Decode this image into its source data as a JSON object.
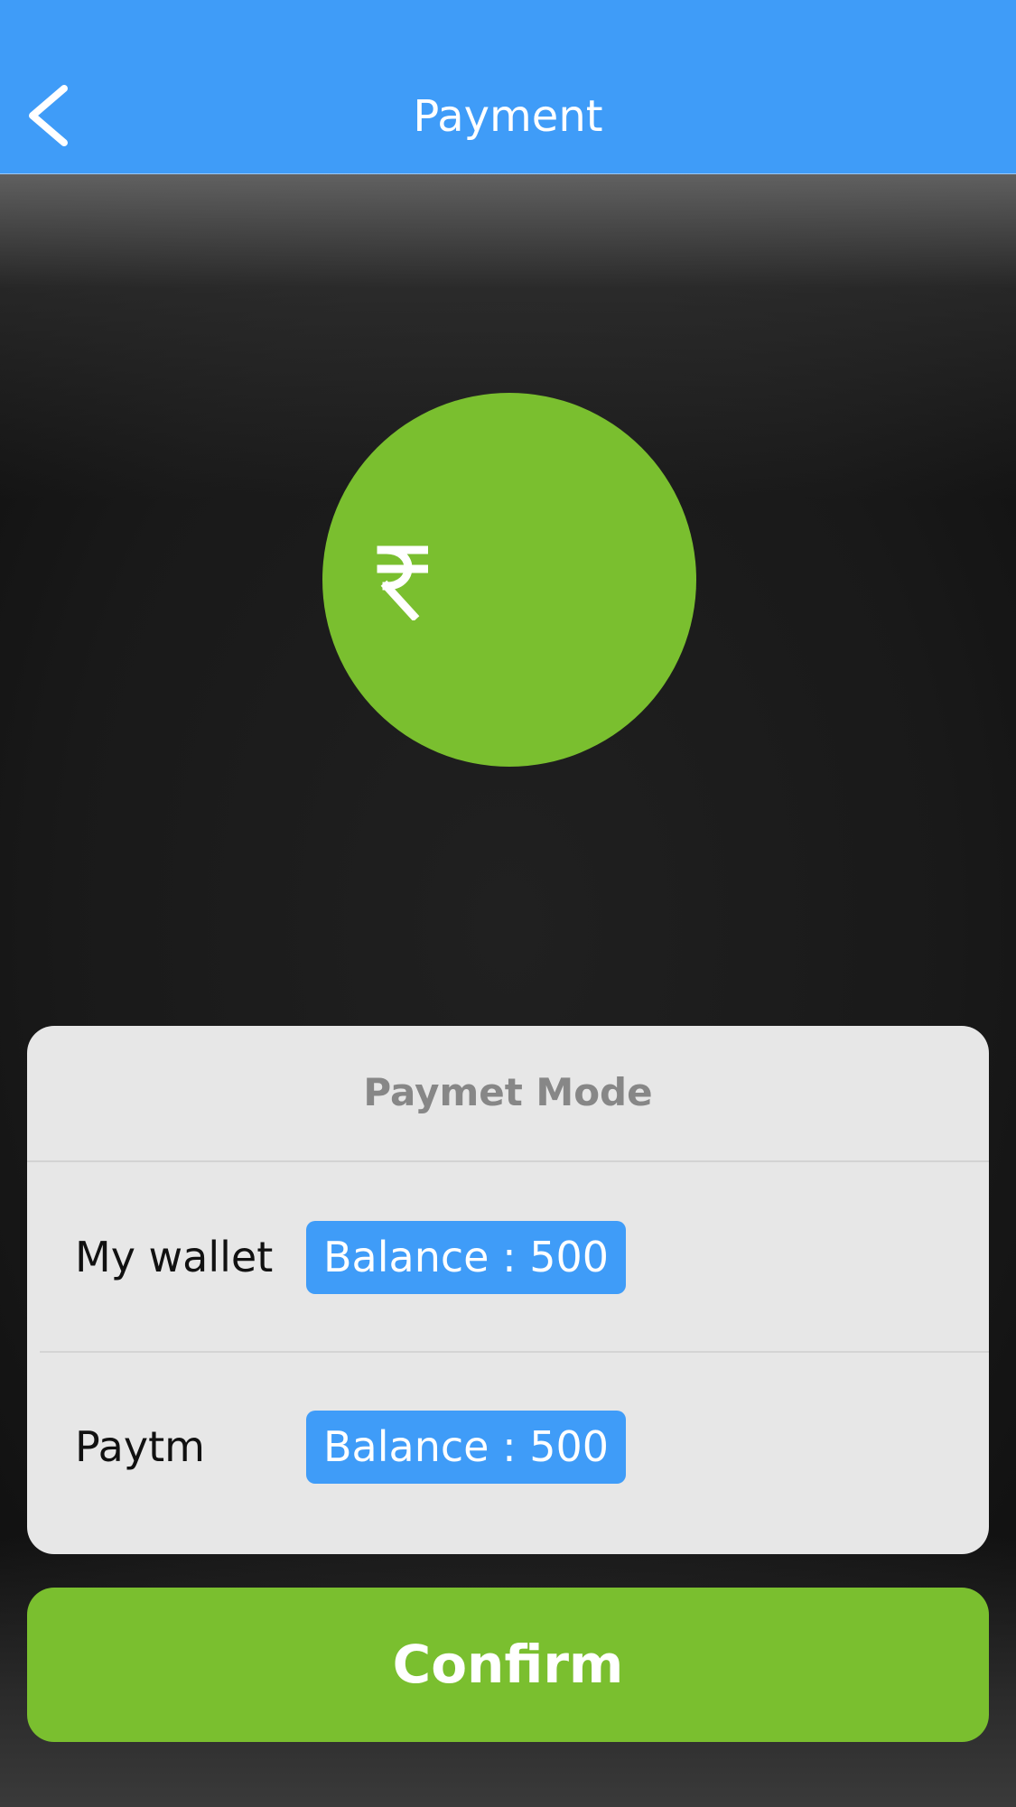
{
  "navbar": {
    "title": "Payment",
    "back_icon": "chevron-left-icon",
    "background_color": "#3f9cf8"
  },
  "hero": {
    "icon": "rupee-icon",
    "circle_color": "#7abf2f"
  },
  "payment_card": {
    "title": "Paymet Mode",
    "options": [
      {
        "label": "My wallet",
        "balance": "Balance : 500"
      },
      {
        "label": "Paytm",
        "balance": "Balance : 500"
      }
    ]
  },
  "confirm_button": {
    "label": "Confirm",
    "color": "#7abf2f"
  }
}
